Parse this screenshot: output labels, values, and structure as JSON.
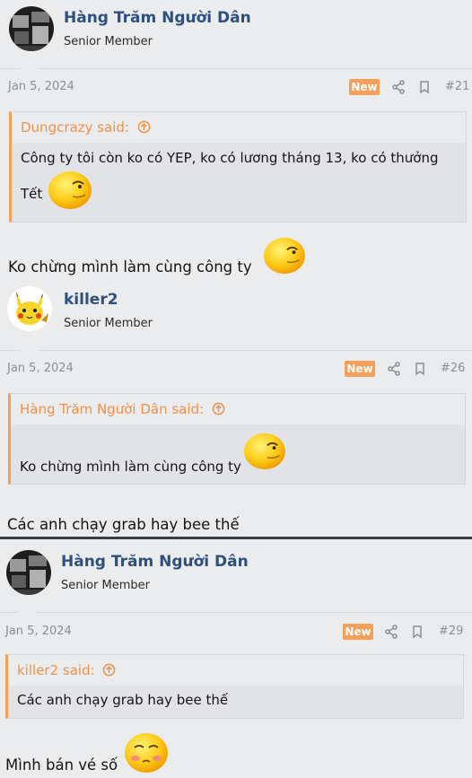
{
  "posts": [
    {
      "username": "Hàng Trăm Người Dân",
      "title": "Senior Member",
      "date": "Jan 5, 2024",
      "badge": "New",
      "number": "#21",
      "quote_author": "Dungcrazy said:",
      "quote_text_1": "Công ty tôi còn ko có YEP, ko có lương tháng 13, ko có thưởng",
      "quote_text_2": "Tết",
      "message": "Ko chừng mình làm cùng công ty"
    },
    {
      "username": "killer2",
      "title": "Senior Member",
      "date": "Jan 5, 2024",
      "badge": "New",
      "number": "#26",
      "quote_author": "Hàng Trăm Người Dân said:",
      "quote_text_1": "Ko chừng mình làm cùng công ty",
      "message": "Các anh chạy grab hay bee thế"
    },
    {
      "username": "Hàng Trăm Người Dân",
      "title": "Senior Member",
      "date": "Jan 5, 2024",
      "badge": "New",
      "number": "#29",
      "quote_author": "killer2 said:",
      "quote_text_1": "Các anh chạy grab hay bee thế",
      "message": "Mình bán vé số"
    }
  ],
  "colors": {
    "accent": "#f5a05a",
    "username": "#2f4f7c",
    "muted": "#8a8f96"
  },
  "icons": [
    "share-icon",
    "bookmark-icon",
    "arrow-up-circle-icon",
    "smirk-emoji-icon",
    "shy-emoji-icon"
  ]
}
